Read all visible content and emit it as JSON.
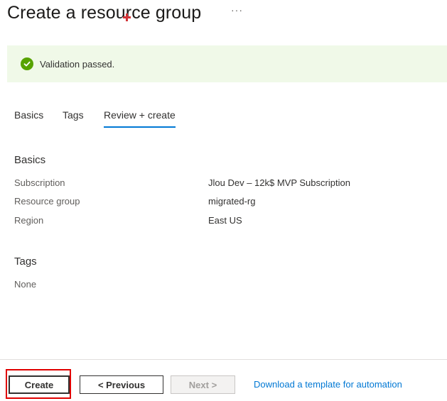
{
  "header": {
    "title": "Create a resource group",
    "more_actions": "···"
  },
  "validation": {
    "icon": "checkmark-circle-icon",
    "message": "Validation passed.",
    "color": "#57a300",
    "background": "#f0f9e8"
  },
  "tabs": [
    {
      "label": "Basics",
      "selected": false
    },
    {
      "label": "Tags",
      "selected": false
    },
    {
      "label": "Review + create",
      "selected": true
    }
  ],
  "basics": {
    "heading": "Basics",
    "rows": [
      {
        "label": "Subscription",
        "value": "Jlou Dev – 12k$ MVP Subscription"
      },
      {
        "label": "Resource group",
        "value": "migrated-rg"
      },
      {
        "label": "Region",
        "value": "East US"
      }
    ]
  },
  "tags": {
    "heading": "Tags",
    "value": "None"
  },
  "footer": {
    "create_label": "Create",
    "previous_label": "< Previous",
    "next_label": "Next >",
    "download_link": "Download a template for automation"
  },
  "colors": {
    "accent": "#0078d4",
    "highlight": "#e00000"
  }
}
